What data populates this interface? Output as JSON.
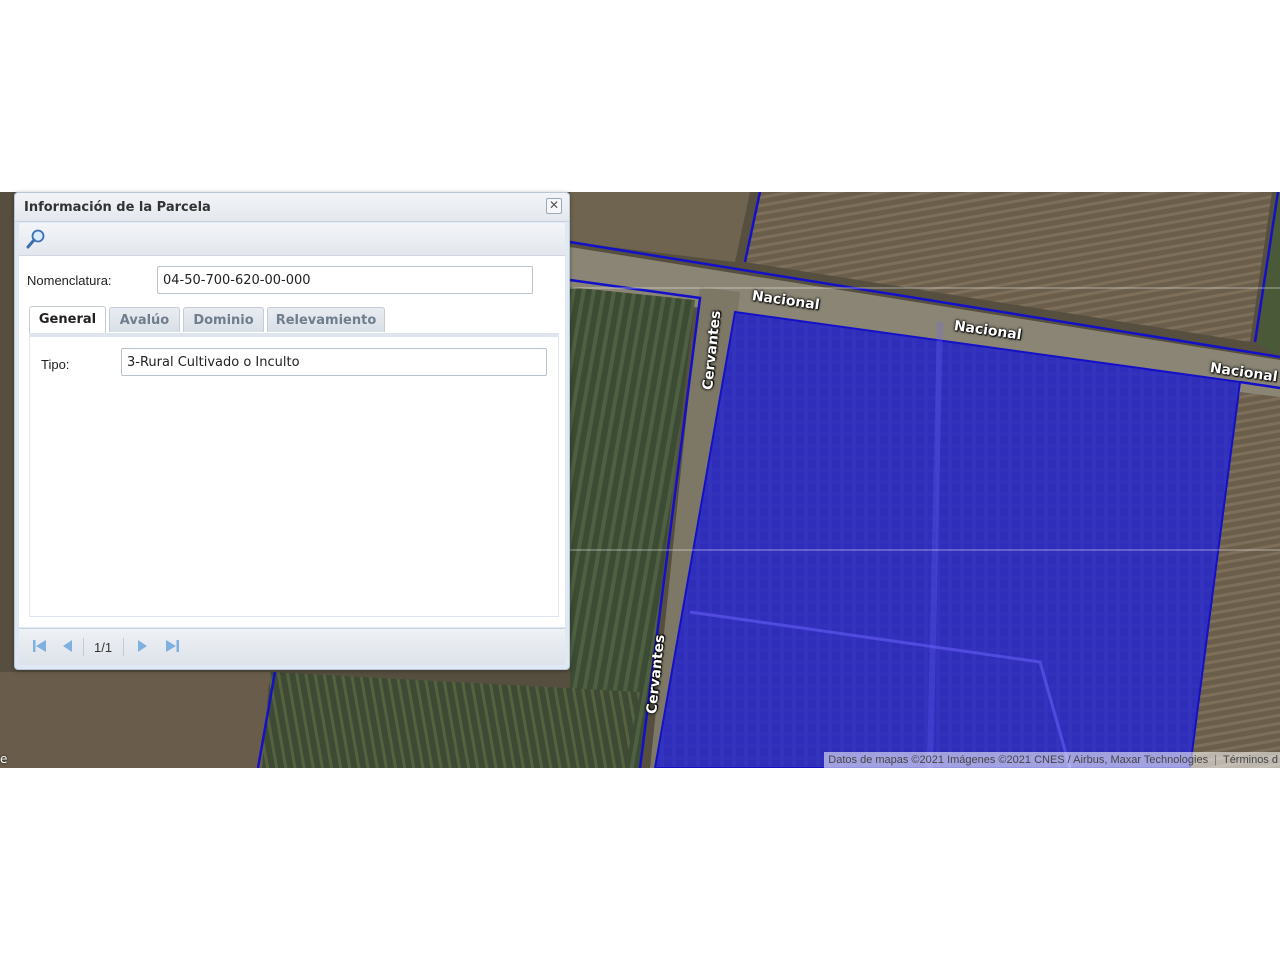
{
  "dialog": {
    "title": "Información de la Parcela",
    "close_symbol": "✕",
    "toolbar_icons": [
      "search-icon"
    ],
    "nomenclatura_label": "Nomenclatura:",
    "nomenclatura_value": "04-50-700-620-00-000",
    "tabs": [
      {
        "label": "General",
        "active": true
      },
      {
        "label": "Avalúo",
        "active": false
      },
      {
        "label": "Dominio",
        "active": false
      },
      {
        "label": "Relevamiento",
        "active": false
      }
    ],
    "general": {
      "tipo_label": "Tipo:",
      "tipo_value": "3-Rural Cultivado o Inculto"
    },
    "pager": {
      "page_info": "1/1",
      "icons": [
        "first-page-icon",
        "prev-page-icon",
        "next-page-icon",
        "last-page-icon"
      ]
    }
  },
  "map": {
    "street_labels": [
      "Nacional",
      "Nacional",
      "Nacional",
      "Cervantes",
      "Cervantes"
    ],
    "attribution": "Datos de mapas ©2021 Imágenes ©2021 CNES / Airbus, Maxar Technologies",
    "terms": "Términos d",
    "left_edge_mark": "e",
    "parcel_fill_color": "#2b24f0",
    "boundary_color": "#1410c8"
  }
}
